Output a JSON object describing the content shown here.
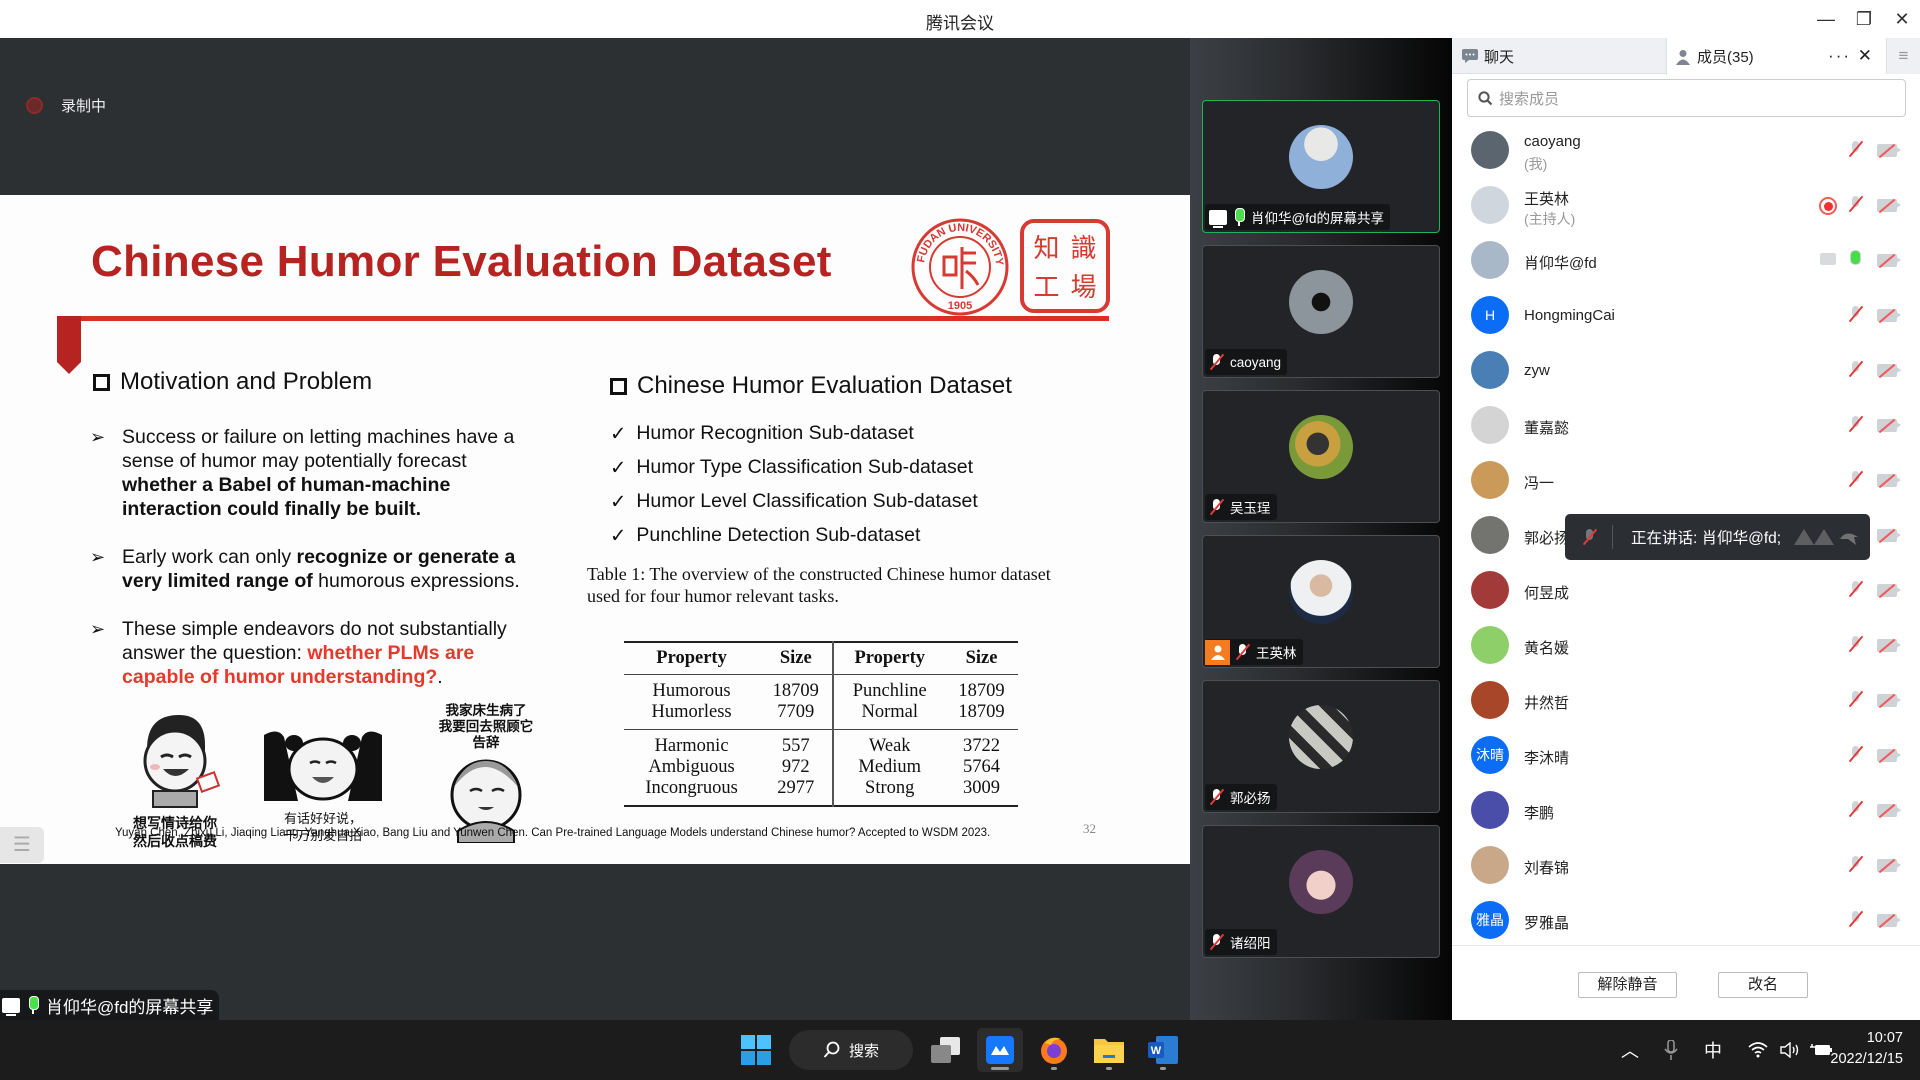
{
  "window": {
    "title": "腾讯会议",
    "minimize": "—",
    "restore": "❐",
    "close": "✕"
  },
  "recording": {
    "label": "录制中"
  },
  "slide": {
    "title": "Chinese Humor Evaluation Dataset",
    "logo_seal": {
      "top_text": "FUDAN UNIVERSITY",
      "year": "1905"
    },
    "logo_box": [
      "知",
      "識",
      "工",
      "場"
    ],
    "left_section": {
      "heading": "Motivation and Problem",
      "bullets": [
        {
          "parts": [
            {
              "text": "Success or failure on letting machines have a sense of humor may potentially forecast ",
              "style": "normal"
            },
            {
              "text": "whether a Babel of human-machine interaction could finally be built.",
              "style": "bold"
            }
          ]
        },
        {
          "parts": [
            {
              "text": "Early work can only ",
              "style": "normal"
            },
            {
              "text": "recognize or generate a very limited range of",
              "style": "bold"
            },
            {
              "text": " humorous expressions.",
              "style": "normal"
            }
          ]
        },
        {
          "parts": [
            {
              "text": "These simple endeavors do not substantially answer the question: ",
              "style": "normal"
            },
            {
              "text": "whether PLMs are capable of humor understanding?",
              "style": "red"
            },
            {
              "text": ".",
              "style": "normal"
            }
          ]
        }
      ]
    },
    "right_section": {
      "heading": "Chinese Humor Evaluation Dataset",
      "checks": [
        "Humor Recognition Sub-dataset",
        "Humor Type Classification Sub-dataset",
        "Humor Level Classification Sub-dataset",
        "Punchline Detection Sub-dataset"
      ],
      "caption": "Table 1:  The overview of the constructed Chinese humor dataset used for four humor relevant tasks.",
      "table": {
        "headers": [
          "Property",
          "Size",
          "Property",
          "Size"
        ],
        "groups": [
          [
            [
              "Humorous",
              "18709",
              "Punchline",
              "18709"
            ],
            [
              "Humorless",
              "7709",
              "Normal",
              "18709"
            ]
          ],
          [
            [
              "Harmonic",
              "557",
              "Weak",
              "3722"
            ],
            [
              "Ambiguous",
              "972",
              "Medium",
              "5764"
            ],
            [
              "Incongruous",
              "2977",
              "Strong",
              "3009"
            ]
          ]
        ]
      }
    },
    "memes": [
      {
        "caption_lines": [
          "想写情诗给你",
          "然后收点稿费"
        ]
      },
      {
        "caption_lines": [
          "有话好好说，",
          "千万别发自拍"
        ]
      },
      {
        "caption_lines": [
          "我家床生病了",
          "我要回去照顾它",
          "告辞"
        ]
      }
    ],
    "citation": "Yuyan Chen, Zhixu Li, Jiaqing Liang, Yanghua Xiao, Bang Liu and Yunwen Chen. Can Pre-trained Language Models understand Chinese humor? Accepted to WSDM 2023.",
    "page_number": "32"
  },
  "share_label": "肖仰华@fd的屏幕共享",
  "video_tiles": [
    {
      "name": "肖仰华@fd的屏幕共享",
      "mic": "on",
      "sharing": true,
      "active": true,
      "avatar_color": "#9bb7d6"
    },
    {
      "name": "caoyang",
      "mic": "off",
      "avatar_color": "#6d7680"
    },
    {
      "name": "吴玉珵",
      "mic": "off",
      "avatar_color": "#7d8a4a"
    },
    {
      "name": "王英林",
      "mic": "off",
      "host": true,
      "avatar_color": "#d9dde2"
    },
    {
      "name": "郭必扬",
      "mic": "off",
      "avatar_color": "#6e6e6a"
    },
    {
      "name": "诸绍阳",
      "mic": "off",
      "avatar_color": "#8a6a7e"
    }
  ],
  "panel": {
    "tabs": {
      "chat": "聊天",
      "members": "成员(35)",
      "more": "···",
      "close": "✕",
      "menu": "≡"
    },
    "search_placeholder": "搜索成员",
    "members": [
      {
        "name": "caoyang",
        "role": "(我)",
        "avatar_color": "#5b6570",
        "mic": "off",
        "cam": "off"
      },
      {
        "name": "王英林",
        "role": "(主持人)",
        "avatar_color": "#cfd6de",
        "mic": "off",
        "cam": "off",
        "recording": true
      },
      {
        "name": "肖仰华@fd",
        "avatar_color": "#a9b8c8",
        "mic": "on",
        "cam": "off",
        "sharing": true
      },
      {
        "name": "HongmingCai",
        "avatar_text": "H",
        "avatar_color": "#0b6cf5",
        "mic": "off",
        "cam": "off"
      },
      {
        "name": "zyw",
        "avatar_color": "#4a7fb5",
        "mic": "off",
        "cam": "off"
      },
      {
        "name": "董嘉懿",
        "avatar_color": "#d4d4d4",
        "mic": "off",
        "cam": "off"
      },
      {
        "name": "冯一",
        "avatar_color": "#c99a5a",
        "mic": "off",
        "cam": "off"
      },
      {
        "name": "郭必扬",
        "avatar_color": "#737370",
        "mic": "off",
        "cam": "off"
      },
      {
        "name": "何昱成",
        "avatar_color": "#a33a3a",
        "mic": "off",
        "cam": "off"
      },
      {
        "name": "黄名媛",
        "avatar_color": "#8fcf6a",
        "mic": "off",
        "cam": "off"
      },
      {
        "name": "井然哲",
        "avatar_color": "#a8462a",
        "mic": "off",
        "cam": "off"
      },
      {
        "name": "李沐晴",
        "avatar_text": "沐晴",
        "avatar_color": "#0b6cf5",
        "mic": "off",
        "cam": "off"
      },
      {
        "name": "李鹏",
        "avatar_color": "#4b4ea8",
        "mic": "off",
        "cam": "off"
      },
      {
        "name": "刘春锦",
        "avatar_color": "#c9a88a",
        "mic": "off",
        "cam": "off"
      },
      {
        "name": "罗雅晶",
        "avatar_text": "雅晶",
        "avatar_color": "#0b6cf5",
        "mic": "off",
        "cam": "off"
      }
    ],
    "unmute_button": "解除静音",
    "rename_button": "改名"
  },
  "speaking_toast": {
    "text": "正在讲话: 肖仰华@fd;"
  },
  "taskbar": {
    "search_label": "搜索",
    "apps": [
      "start",
      "task-view",
      "tencent-meeting",
      "firefox",
      "file-explorer",
      "word"
    ],
    "active_app": "tencent-meeting",
    "tray": {
      "ime": "中"
    },
    "time": "10:07",
    "date": "2022/12/15"
  }
}
